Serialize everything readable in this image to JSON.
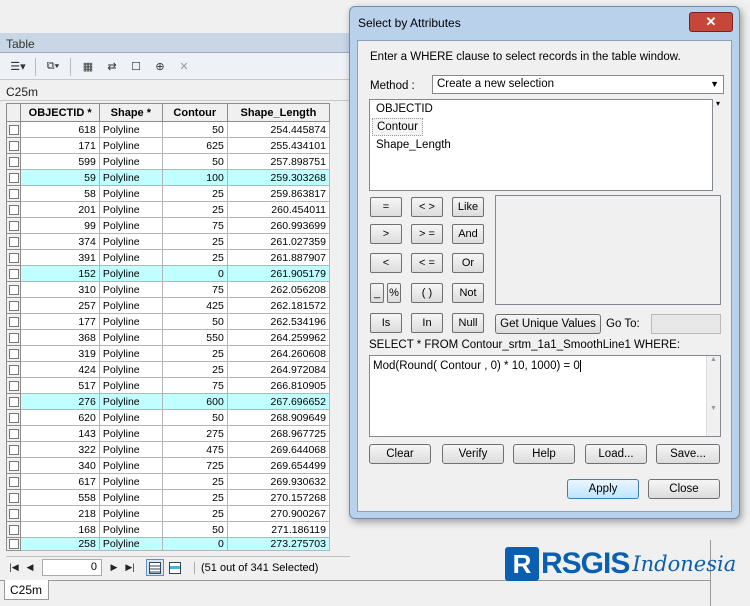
{
  "table_window": {
    "title": "Table",
    "tab_name": "C25m",
    "columns": [
      "OBJECTID *",
      "Shape *",
      "Contour",
      "Shape_Length"
    ],
    "rows": [
      {
        "oid": "618",
        "shape": "Polyline",
        "contour": "50",
        "length": "254.445874",
        "hl": false
      },
      {
        "oid": "171",
        "shape": "Polyline",
        "contour": "625",
        "length": "255.434101",
        "hl": false
      },
      {
        "oid": "599",
        "shape": "Polyline",
        "contour": "50",
        "length": "257.898751",
        "hl": false
      },
      {
        "oid": "59",
        "shape": "Polyline",
        "contour": "100",
        "length": "259.303268",
        "hl": true
      },
      {
        "oid": "58",
        "shape": "Polyline",
        "contour": "25",
        "length": "259.863817",
        "hl": false
      },
      {
        "oid": "201",
        "shape": "Polyline",
        "contour": "25",
        "length": "260.454011",
        "hl": false
      },
      {
        "oid": "99",
        "shape": "Polyline",
        "contour": "75",
        "length": "260.993699",
        "hl": false
      },
      {
        "oid": "374",
        "shape": "Polyline",
        "contour": "25",
        "length": "261.027359",
        "hl": false
      },
      {
        "oid": "391",
        "shape": "Polyline",
        "contour": "25",
        "length": "261.887907",
        "hl": false
      },
      {
        "oid": "152",
        "shape": "Polyline",
        "contour": "0",
        "length": "261.905179",
        "hl": true
      },
      {
        "oid": "310",
        "shape": "Polyline",
        "contour": "75",
        "length": "262.056208",
        "hl": false
      },
      {
        "oid": "257",
        "shape": "Polyline",
        "contour": "425",
        "length": "262.181572",
        "hl": false
      },
      {
        "oid": "177",
        "shape": "Polyline",
        "contour": "50",
        "length": "262.534196",
        "hl": false
      },
      {
        "oid": "368",
        "shape": "Polyline",
        "contour": "550",
        "length": "264.259962",
        "hl": false
      },
      {
        "oid": "319",
        "shape": "Polyline",
        "contour": "25",
        "length": "264.260608",
        "hl": false
      },
      {
        "oid": "424",
        "shape": "Polyline",
        "contour": "25",
        "length": "264.972084",
        "hl": false
      },
      {
        "oid": "517",
        "shape": "Polyline",
        "contour": "75",
        "length": "266.810905",
        "hl": false
      },
      {
        "oid": "276",
        "shape": "Polyline",
        "contour": "600",
        "length": "267.696652",
        "hl": true
      },
      {
        "oid": "620",
        "shape": "Polyline",
        "contour": "50",
        "length": "268.909649",
        "hl": false
      },
      {
        "oid": "143",
        "shape": "Polyline",
        "contour": "275",
        "length": "268.967725",
        "hl": false
      },
      {
        "oid": "322",
        "shape": "Polyline",
        "contour": "475",
        "length": "269.644068",
        "hl": false
      },
      {
        "oid": "340",
        "shape": "Polyline",
        "contour": "725",
        "length": "269.654499",
        "hl": false
      },
      {
        "oid": "617",
        "shape": "Polyline",
        "contour": "25",
        "length": "269.930632",
        "hl": false
      },
      {
        "oid": "558",
        "shape": "Polyline",
        "contour": "25",
        "length": "270.157268",
        "hl": false
      },
      {
        "oid": "218",
        "shape": "Polyline",
        "contour": "25",
        "length": "270.900267",
        "hl": false
      },
      {
        "oid": "168",
        "shape": "Polyline",
        "contour": "50",
        "length": "271.186119",
        "hl": false
      },
      {
        "oid": "258",
        "shape": "Polyline",
        "contour": "0",
        "length": "273.275703",
        "hl": true
      }
    ],
    "record_number": "0",
    "selection_status": "(51 out of 341 Selected)",
    "bottom_tab": "C25m"
  },
  "dialog": {
    "title": "Select by Attributes",
    "close_label": "✕",
    "instruction": "Enter a WHERE clause to select records in the table window.",
    "method_label": "Method :",
    "method_value": "Create a new selection",
    "fields": [
      "OBJECTID",
      "Contour",
      "Shape_Length"
    ],
    "operators": [
      "=",
      "< >",
      "Like",
      ">",
      "> =",
      "And",
      "<",
      "< =",
      "Or",
      "_",
      "%",
      "( )",
      "Not",
      "Is",
      "In",
      "Null"
    ],
    "unique_values_label": "Get Unique Values",
    "goto_label": "Go To:",
    "sql_prefix": "SELECT * FROM Contour_srtm_1a1_SmoothLine1 WHERE:",
    "expression": "Mod(Round( Contour , 0) * 10, 1000) = 0",
    "buttons": {
      "clear": "Clear",
      "verify": "Verify",
      "help": "Help",
      "load": "Load...",
      "save": "Save...",
      "apply": "Apply",
      "close": "Close"
    }
  },
  "watermark": {
    "r": "R",
    "main": "RSGIS",
    "sub": "Indonesia"
  }
}
